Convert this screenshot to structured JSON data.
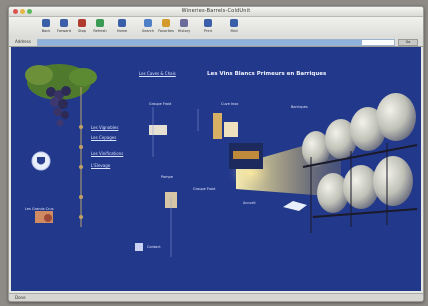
{
  "window": {
    "title": "Wineries-Barrels-ColdUnit"
  },
  "toolbar": {
    "buttons": [
      {
        "label": "Back",
        "icon": "back-arrow-icon"
      },
      {
        "label": "Forward",
        "icon": "forward-arrow-icon"
      },
      {
        "label": "Stop",
        "icon": "stop-icon"
      },
      {
        "label": "Refresh",
        "icon": "refresh-icon"
      },
      {
        "label": "Home",
        "icon": "home-icon"
      },
      {
        "label": "Search",
        "icon": "search-icon"
      },
      {
        "label": "Favorites",
        "icon": "favorites-icon"
      },
      {
        "label": "History",
        "icon": "history-icon"
      },
      {
        "label": "Print",
        "icon": "print-icon"
      },
      {
        "label": "Mail",
        "icon": "mail-icon"
      }
    ]
  },
  "address": {
    "label": "Address",
    "go": "Go",
    "progress": 0.91
  },
  "page": {
    "heading": "Les Vins Blancs Primeurs en Barriques",
    "subheading": "Les Caves & Chais",
    "left_links": [
      "Les Vignobles",
      "Les Cepages",
      "Les Vinifications",
      "L'Elevage"
    ],
    "left_small_text": "Les Grands Crus",
    "cold_label": "Groupe Froid",
    "barrel_label": "Barriques",
    "cuve_label": "Cuve Inox",
    "bottom_label": "Contact",
    "pump_label": "Pompe",
    "fish_label": "Accueil"
  },
  "status": {
    "text": "Done"
  },
  "colors": {
    "page_bg": "#22388a",
    "barrel": "#d7d7cf",
    "light": "#f6e8a8"
  }
}
